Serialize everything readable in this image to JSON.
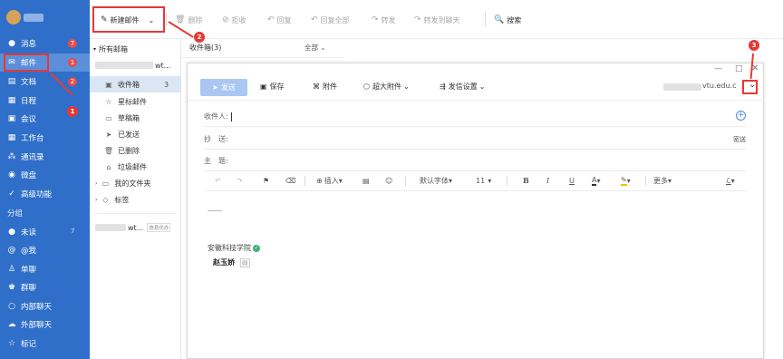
{
  "sidebar": {
    "items": [
      {
        "label": "消息",
        "icon": "chat-icon",
        "badge": "7"
      },
      {
        "label": "邮件",
        "icon": "mail-icon",
        "badge": "1"
      },
      {
        "label": "文档",
        "icon": "document-icon",
        "badge": "2"
      },
      {
        "label": "日程",
        "icon": "calendar-icon"
      },
      {
        "label": "会议",
        "icon": "meeting-icon"
      },
      {
        "label": "工作台",
        "icon": "grid-icon"
      },
      {
        "label": "通讯录",
        "icon": "contacts-icon"
      },
      {
        "label": "微盘",
        "icon": "disk-icon"
      },
      {
        "label": "高级功能",
        "icon": "advanced-icon"
      }
    ],
    "group_title": "分组",
    "groups": [
      {
        "label": "未读",
        "icon": "chat-icon",
        "count": "7"
      },
      {
        "label": "@我",
        "icon": "at-icon"
      },
      {
        "label": "单聊",
        "icon": "person-icon"
      },
      {
        "label": "群聊",
        "icon": "group-icon"
      },
      {
        "label": "内部聊天",
        "icon": "chat-icon"
      },
      {
        "label": "外部聊天",
        "icon": "cloud-chat-icon"
      },
      {
        "label": "标记",
        "icon": "star-icon"
      }
    ]
  },
  "toolbar": {
    "new_mail": "新建邮件",
    "delete": "删除",
    "recall": "拒收",
    "reply": "回复",
    "reply_all": "回复全部",
    "forward": "转发",
    "forward_chat": "转发到聊天",
    "search": "搜索"
  },
  "folders": {
    "all_mail": "所有邮箱",
    "account_suffix": "wt...",
    "items": [
      {
        "label": "收件箱",
        "icon": "inbox-icon",
        "count": "3"
      },
      {
        "label": "星标邮件",
        "icon": "star-icon"
      },
      {
        "label": "草稿箱",
        "icon": "draft-icon"
      },
      {
        "label": "已发送",
        "icon": "send-icon"
      },
      {
        "label": "已删除",
        "icon": "trash-icon"
      },
      {
        "label": "垃圾邮件",
        "icon": "spam-icon"
      },
      {
        "label": "我的文件夹",
        "icon": "folder-icon"
      },
      {
        "label": "标签",
        "icon": "tag-icon"
      }
    ],
    "account2_suffix": "wt...",
    "account2_badge": "信息化办"
  },
  "list": {
    "title": "收件箱(3)",
    "filter": "全部"
  },
  "compose": {
    "send": "发送",
    "save": "保存",
    "attach": "附件",
    "big_attach": "超大附件",
    "send_settings": "发信设置",
    "sender_suffix": "vtu.edu.c",
    "to_label": "收件人:",
    "cc_label": "抄　送:",
    "bcc": "密送",
    "subject_label": "主　题:",
    "format": {
      "insert": "插入",
      "font": "默认字体",
      "size": "11",
      "more": "更多"
    },
    "signature_org": "安徽科技学院",
    "signature_name": "赵玉娇"
  },
  "annotations": [
    "1",
    "2",
    "3"
  ],
  "colors": {
    "sidebar": "#2f6fc9",
    "accent": "#4e8ae6",
    "annotation": "#e53935"
  }
}
